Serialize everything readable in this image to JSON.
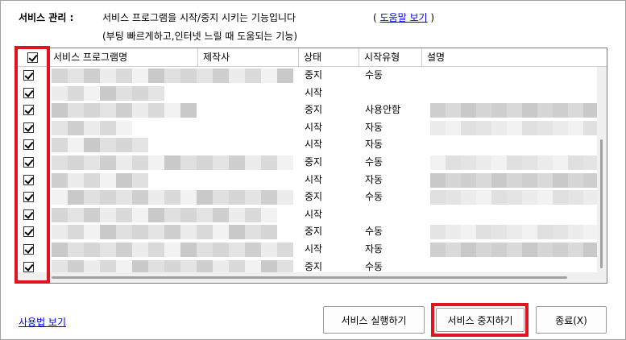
{
  "header": {
    "title": "서비스 관리 :",
    "description": "서비스 프로그램을 시작/중지 시키는 기능입니다",
    "help_open": "(",
    "help_link": "도움말 보기",
    "help_close": ")",
    "subtitle": "(부팅 빠르게하고,인터넷 느릴 때 도움되는 기능)"
  },
  "table": {
    "columns": [
      "서비스 프로그램명",
      "제작사",
      "상태",
      "시작유형",
      "설명"
    ],
    "rows": [
      {
        "status": "중지",
        "start_type": "수동"
      },
      {
        "status": "시작",
        "start_type": ""
      },
      {
        "status": "중지",
        "start_type": "사용안함"
      },
      {
        "status": "시작",
        "start_type": "자동"
      },
      {
        "status": "시작",
        "start_type": "자동"
      },
      {
        "status": "중지",
        "start_type": "수동"
      },
      {
        "status": "시작",
        "start_type": "자동"
      },
      {
        "status": "중지",
        "start_type": "수동"
      },
      {
        "status": "시작",
        "start_type": ""
      },
      {
        "status": "중지",
        "start_type": "수동"
      },
      {
        "status": "시작",
        "start_type": "자동"
      },
      {
        "status": "중지",
        "start_type": "수동"
      }
    ]
  },
  "footer": {
    "usage_link": "사용법 보기",
    "run_button": "서비스 실행하기",
    "stop_button": "서비스 중지하기",
    "exit_button": "종료(X)"
  },
  "colors": {
    "highlight": "#e0141e",
    "link": "#0000ee"
  }
}
